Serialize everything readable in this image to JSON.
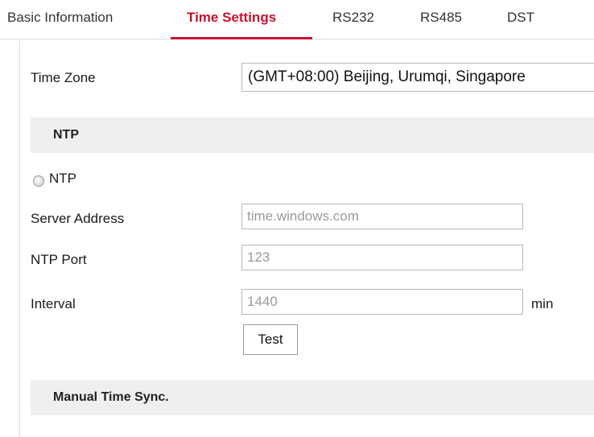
{
  "tabs": [
    {
      "label": "Basic Information"
    },
    {
      "label": "Time Settings"
    },
    {
      "label": "RS232"
    },
    {
      "label": "RS485"
    },
    {
      "label": "DST"
    }
  ],
  "active_tab": "Time Settings",
  "accent_color": "#c8102e",
  "time_zone": {
    "label": "Time Zone",
    "value": "(GMT+08:00) Beijing, Urumqi, Singapore"
  },
  "ntp_section": {
    "title": "NTP",
    "radio_label": "NTP",
    "radio_selected": false,
    "server_address": {
      "label": "Server Address",
      "value": "time.windows.com"
    },
    "ntp_port": {
      "label": "NTP Port",
      "value": "123"
    },
    "interval": {
      "label": "Interval",
      "value": "1440",
      "unit": "min"
    },
    "test_button": "Test"
  },
  "manual_section": {
    "title": "Manual Time Sync."
  }
}
